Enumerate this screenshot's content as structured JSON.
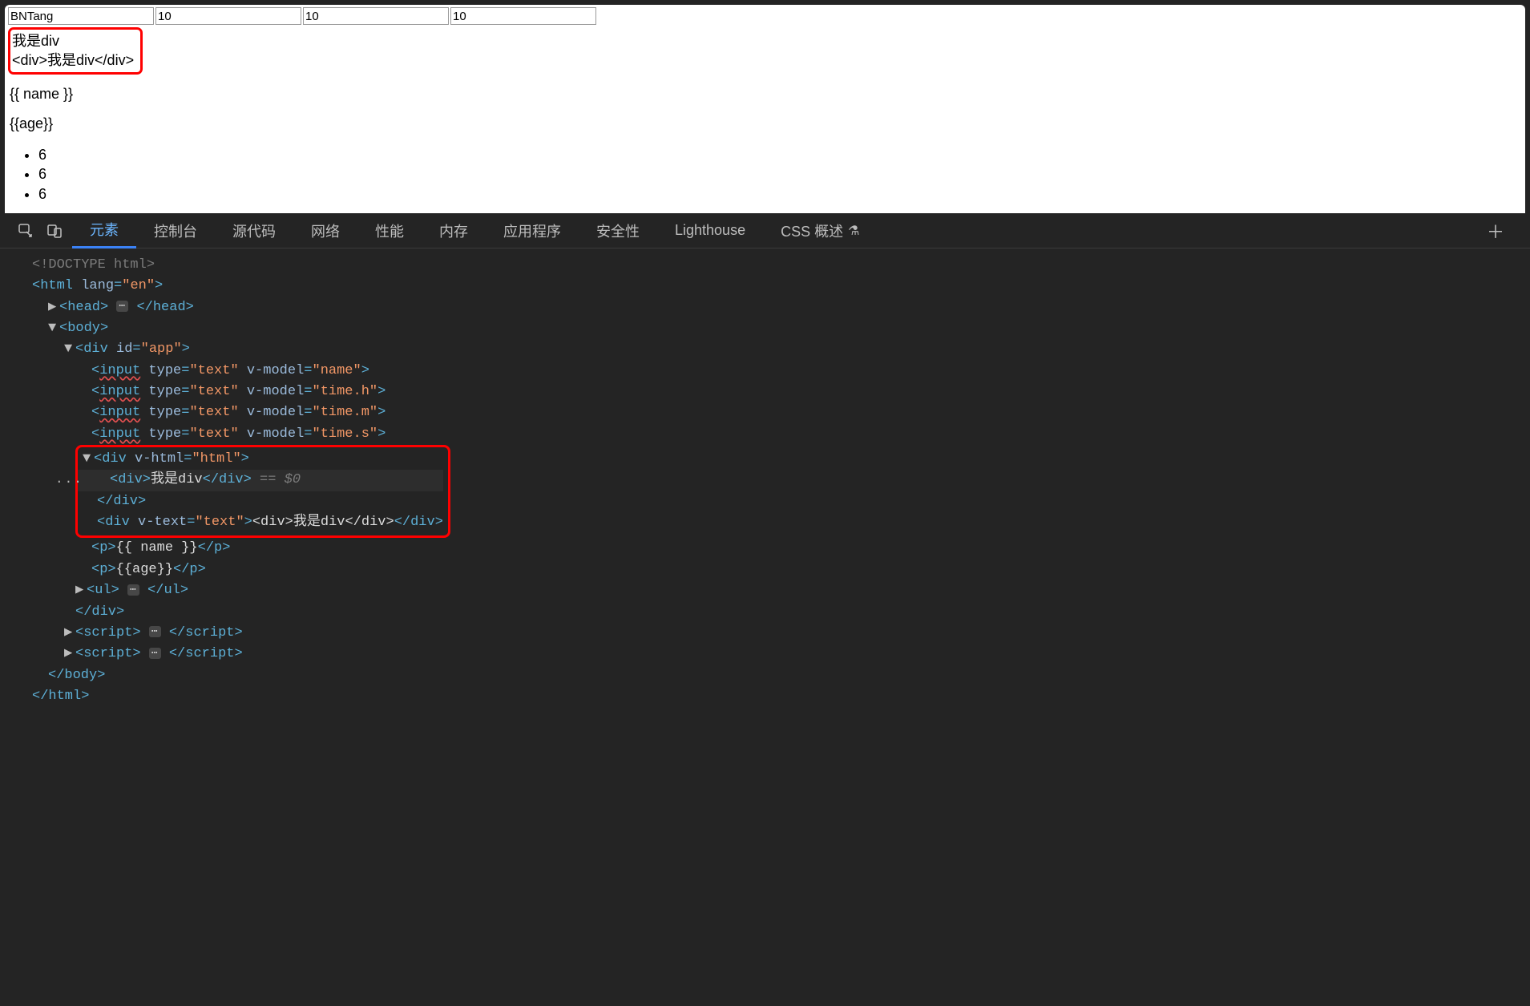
{
  "page": {
    "inputs": {
      "name": "BNTang",
      "h": "10",
      "m": "10",
      "s": "10"
    },
    "vhtml_rendered": "我是div",
    "vtext_rendered": "<div>我是div</div>",
    "p_name": "{{ name }}",
    "p_age": "{{age}}",
    "list_items": [
      "6",
      "6",
      "6"
    ]
  },
  "devtools": {
    "tabs": [
      "元素",
      "控制台",
      "源代码",
      "网络",
      "性能",
      "内存",
      "应用程序",
      "安全性",
      "Lighthouse",
      "CSS 概述"
    ],
    "active_tab_index": 0,
    "tree": {
      "doctype": "<!DOCTYPE html>",
      "html_open": {
        "tag": "html",
        "attrs": [
          [
            "lang",
            "en"
          ]
        ]
      },
      "head": {
        "tag": "head",
        "collapsed": true
      },
      "body_open": {
        "tag": "body"
      },
      "app_open": {
        "tag": "div",
        "attrs": [
          [
            "id",
            "app"
          ]
        ]
      },
      "inputs": [
        {
          "attrs": [
            [
              "type",
              "text"
            ],
            [
              "v-model",
              "name"
            ]
          ]
        },
        {
          "attrs": [
            [
              "type",
              "text"
            ],
            [
              "v-model",
              "time.h"
            ]
          ]
        },
        {
          "attrs": [
            [
              "type",
              "text"
            ],
            [
              "v-model",
              "time.m"
            ]
          ]
        },
        {
          "attrs": [
            [
              "type",
              "text"
            ],
            [
              "v-model",
              "time.s"
            ]
          ]
        }
      ],
      "vhtml_open": {
        "tag": "div",
        "attrs": [
          [
            "v-html",
            "html"
          ]
        ]
      },
      "vhtml_child": {
        "open": "<div>",
        "text": "我是div",
        "close": "</div>",
        "suffix": " == $0"
      },
      "vhtml_close": "</div>",
      "vtext_line": {
        "open_tag": "div",
        "open_attrs": [
          [
            "v-text",
            "text"
          ]
        ],
        "inner_open": "<div>",
        "inner_text": "我是div",
        "inner_close": "</div>",
        "outer_close": "</div>"
      },
      "p_name": {
        "text": "{{ name }}"
      },
      "p_age": {
        "text": "{{age}}"
      },
      "ul": {
        "collapsed": true
      },
      "div_close": "</div>",
      "scripts": 2,
      "body_close": "</body>",
      "html_close": "</html>"
    }
  }
}
